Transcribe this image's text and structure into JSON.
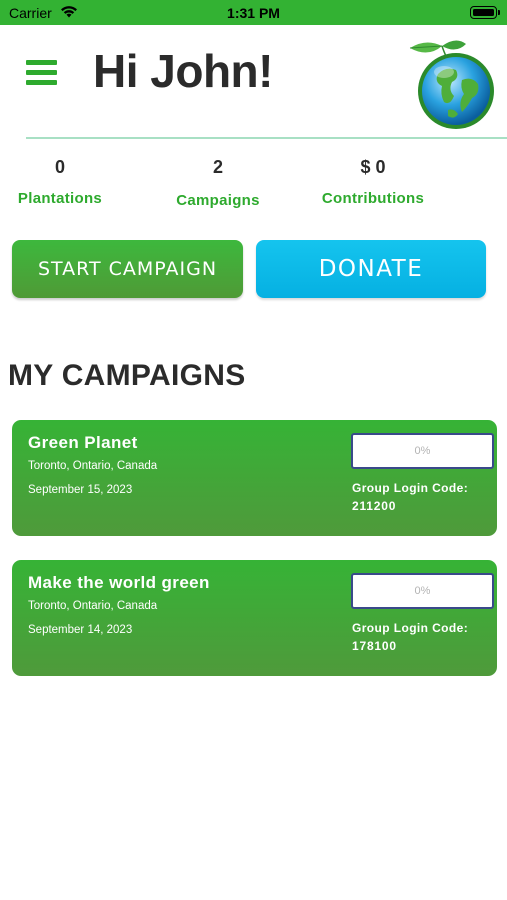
{
  "status_bar": {
    "carrier": "Carrier",
    "time": "1:31 PM",
    "icons": [
      "wifi-icon",
      "battery-icon"
    ]
  },
  "header": {
    "greeting": "Hi John!",
    "menu_icon": "hamburger-menu-icon",
    "logo_icon": "globe-with-leaves-logo"
  },
  "stats": [
    {
      "value": "0",
      "label": "Plantations"
    },
    {
      "value": "2",
      "label": "Campaigns"
    },
    {
      "value": "$ 0",
      "label": "Contributions"
    }
  ],
  "actions": {
    "start_campaign": "START CAMPAIGN",
    "donate": "DONATE"
  },
  "section_title": "MY CAMPAIGNS",
  "campaigns": [
    {
      "name": "Green Planet",
      "location": "Toronto, Ontario, Canada",
      "date": "September 15, 2023",
      "progress": "0%",
      "code_label": "Group Login Code:",
      "code": "211200"
    },
    {
      "name": "Make the world green",
      "location": "Toronto, Ontario, Canada",
      "date": "September 14, 2023",
      "progress": "0%",
      "code_label": "Group Login Code:",
      "code": "178100"
    }
  ],
  "colors": {
    "brand_green": "#2eaa2e",
    "status_bar": "#33b233",
    "donate_blue": "#05b0e2",
    "divider": "#a8e0c4"
  }
}
